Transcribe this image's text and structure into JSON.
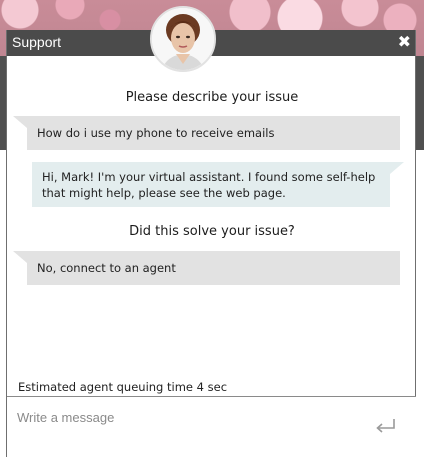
{
  "window": {
    "title": "Support",
    "close_label": "✖"
  },
  "chat": {
    "messages": [
      {
        "kind": "prompt",
        "text": "Please describe your issue"
      },
      {
        "kind": "user",
        "text": "How do i use my phone to receive emails"
      },
      {
        "kind": "bot",
        "text": "Hi, Mark! I'm your virtual assistant. I found some self-help that might help, please see the web page."
      },
      {
        "kind": "prompt",
        "text": "Did this solve your issue?"
      },
      {
        "kind": "user",
        "text": "No, connect to an agent"
      }
    ],
    "queue_status": "Estimated agent queuing time 4 sec"
  },
  "composer": {
    "placeholder": "Write a message",
    "send_icon": "enter-arrow-icon"
  },
  "colors": {
    "titlebar": "#4b4b4b",
    "user_bubble": "#e2e2e2",
    "bot_bubble": "#e3edee"
  }
}
